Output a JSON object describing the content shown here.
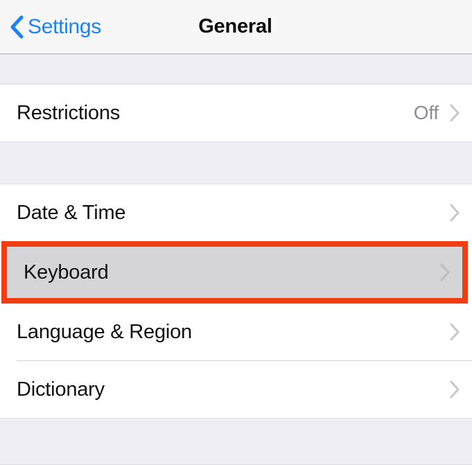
{
  "navbar": {
    "back_label": "Settings",
    "back_icon": "chevron-left-icon",
    "title": "General"
  },
  "colors": {
    "tint": "#1a82fb",
    "highlight_border": "#f23c12",
    "pressed_row_background": "#d5d5d7",
    "group_background": "#efeef4",
    "value_text": "#8e8e93",
    "chevron": "#c7c7cc"
  },
  "sections": [
    {
      "rows": [
        {
          "label": "Restrictions",
          "value": "Off",
          "accessory": "disclosure-chevron-icon",
          "highlighted": false
        }
      ]
    },
    {
      "rows": [
        {
          "label": "Date & Time",
          "value": "",
          "accessory": "disclosure-chevron-icon",
          "highlighted": false
        },
        {
          "label": "Keyboard",
          "value": "",
          "accessory": "disclosure-chevron-icon",
          "highlighted": true
        },
        {
          "label": "Language & Region",
          "value": "",
          "accessory": "disclosure-chevron-icon",
          "highlighted": false
        },
        {
          "label": "Dictionary",
          "value": "",
          "accessory": "disclosure-chevron-icon",
          "highlighted": false
        }
      ]
    }
  ]
}
